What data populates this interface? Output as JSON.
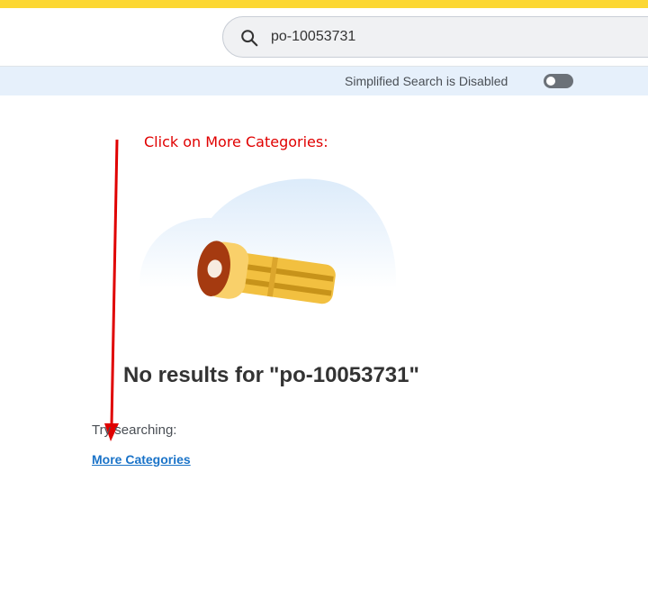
{
  "search": {
    "query": "po-10053731"
  },
  "settings_bar": {
    "simplified_search_label": "Simplified Search is Disabled",
    "simplified_search_enabled": false
  },
  "annotation": {
    "text": "Click on More Categories:"
  },
  "results": {
    "heading_prefix": "No results for",
    "heading_query": "\"po-10053731\"",
    "try_label": "Try searching:",
    "more_categories_link": "More Categories"
  },
  "colors": {
    "top_strip": "#fcd733",
    "settings_bar_bg": "#e6f0fb",
    "link": "#1a73c8",
    "annotation": "#e00000"
  },
  "icons": {
    "search": "magnifier-icon",
    "illustration": "flashlight-illustration",
    "arrow": "red-arrow-annotation"
  }
}
